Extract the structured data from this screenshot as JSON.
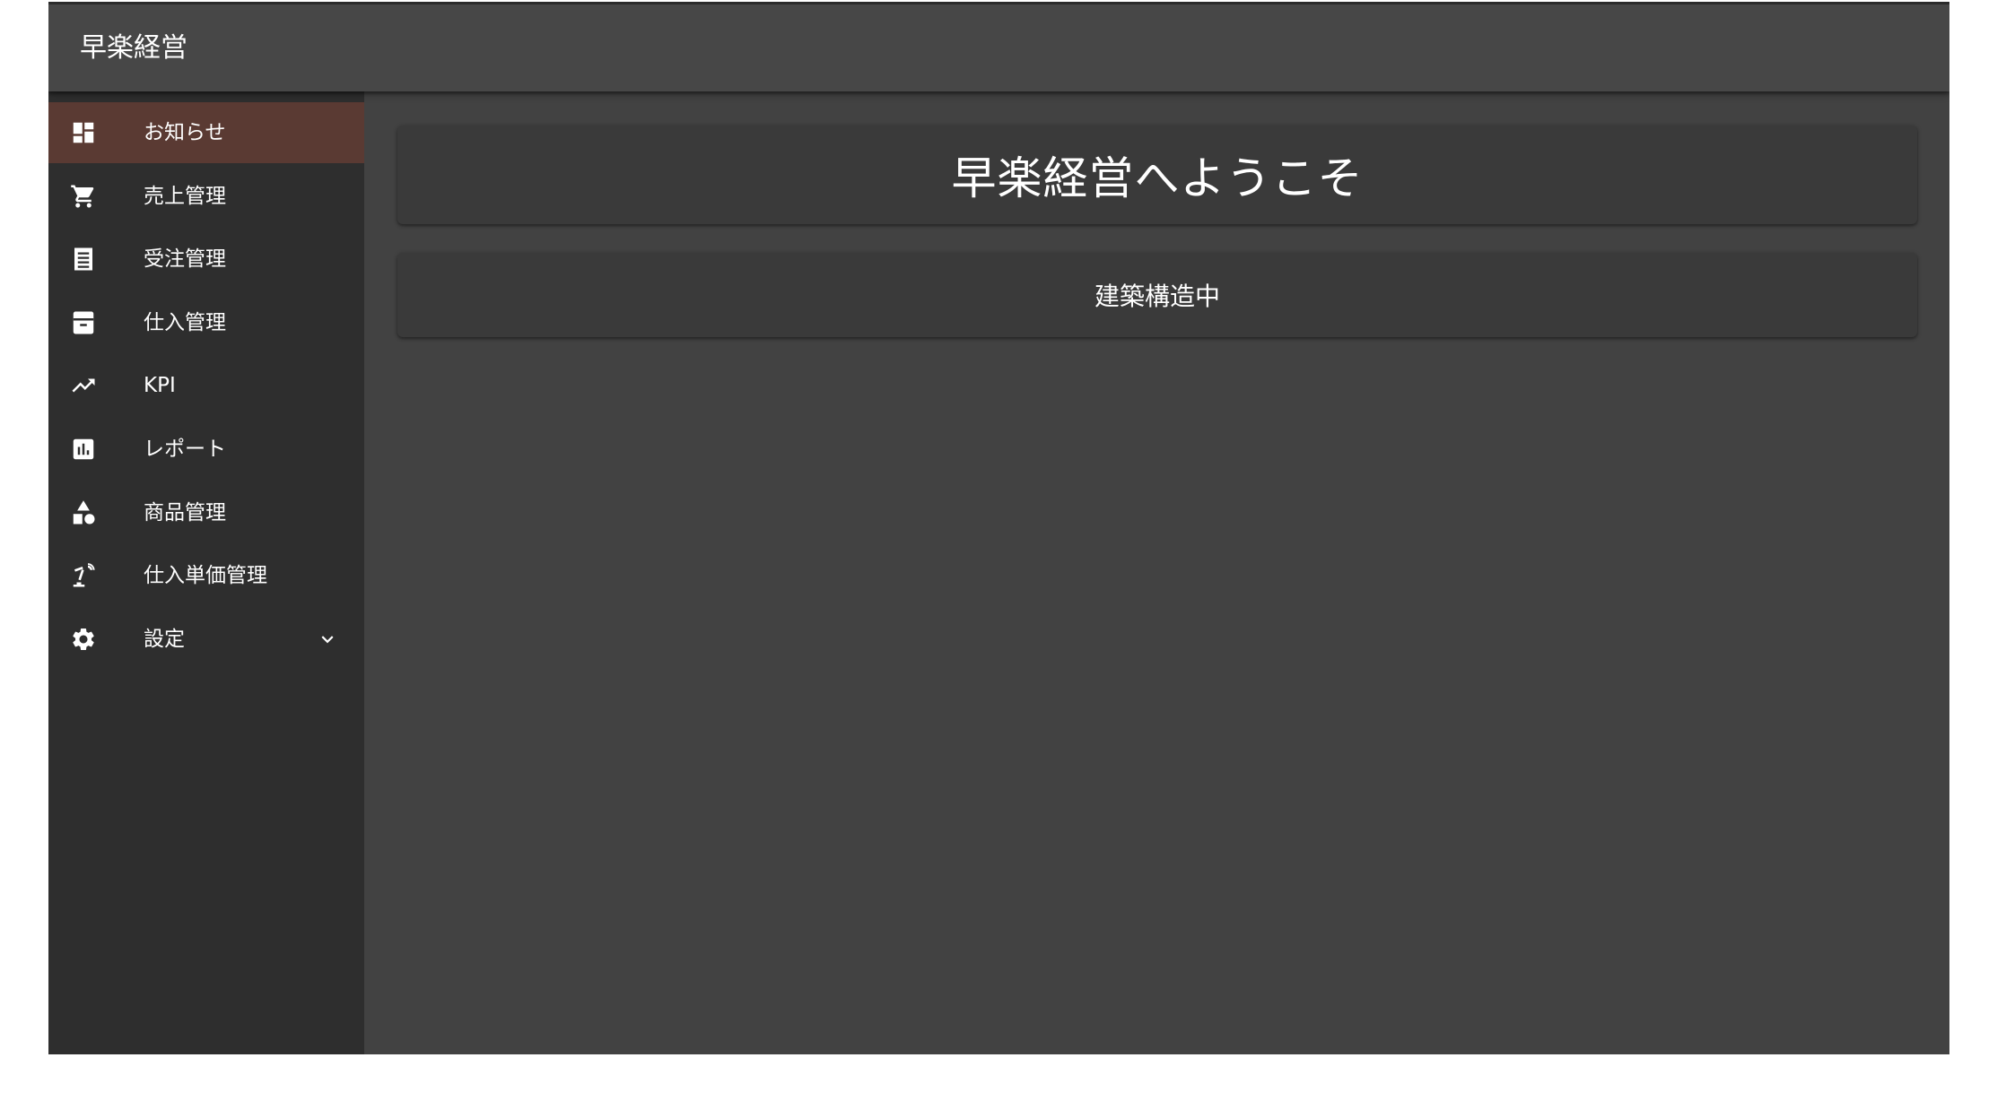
{
  "app": {
    "title": "早楽経営"
  },
  "sidebar": {
    "items": [
      {
        "label": "お知らせ",
        "icon": "dashboard-icon",
        "active": true
      },
      {
        "label": "売上管理",
        "icon": "shopping-cart-icon"
      },
      {
        "label": "受注管理",
        "icon": "receipt-list-icon"
      },
      {
        "label": "仕入管理",
        "icon": "archive-box-icon"
      },
      {
        "label": "KPI",
        "icon": "trending-up-icon"
      },
      {
        "label": "レポート",
        "icon": "bar-chart-icon"
      },
      {
        "label": "商品管理",
        "icon": "category-shapes-icon"
      },
      {
        "label": "仕入単価管理",
        "icon": "precision-tool-icon"
      },
      {
        "label": "設定",
        "icon": "gear-icon",
        "expandable": true,
        "expand_icon": "chevron-down-icon"
      }
    ]
  },
  "main": {
    "welcome_title": "早楽経営へようこそ",
    "status_text": "建築構造中"
  },
  "colors": {
    "appbar": "#474747",
    "sidebar": "#2e2e2e",
    "content": "#424242",
    "active_item": "#5a3a33",
    "card": "#3a3a3a",
    "text": "#ffffff"
  }
}
